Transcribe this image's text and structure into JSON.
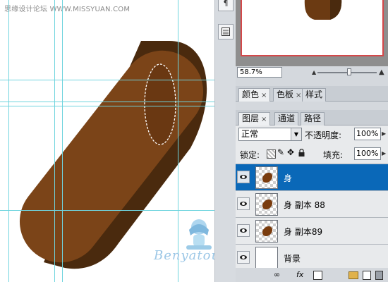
{
  "canvas": {
    "site_credit": "思缘设计论坛 WWW.MISSYUAN.COM",
    "watermark": "Benyatou"
  },
  "colors": {
    "bean_front": "#7b4418",
    "bean_side": "#4a2a0e",
    "guide": "#6fd4de",
    "selection_highlight": "#0a68b8"
  },
  "toolbar_strip": {
    "icons": [
      "paragraph-icon",
      "panel-icon"
    ]
  },
  "navigator": {
    "zoom": "58.7%"
  },
  "color_panel": {
    "tabs": [
      {
        "label": "颜色",
        "close": "×"
      },
      {
        "label": "色板",
        "close": "×"
      },
      {
        "label": "样式"
      }
    ]
  },
  "layers_panel": {
    "tabs": [
      {
        "label": "图层",
        "close": "×"
      },
      {
        "label": "通道"
      },
      {
        "label": "路径"
      }
    ],
    "blend_mode": "正常",
    "opacity_label": "不透明度:",
    "opacity": "100%",
    "lock_label": "锁定:",
    "fill_label": "填充:",
    "fill": "100%",
    "layers": [
      {
        "name": "身",
        "selected": true
      },
      {
        "name": "身 副本 88",
        "selected": false
      },
      {
        "name": "身 副本89",
        "selected": false
      },
      {
        "name": "背景",
        "selected": false
      }
    ]
  }
}
